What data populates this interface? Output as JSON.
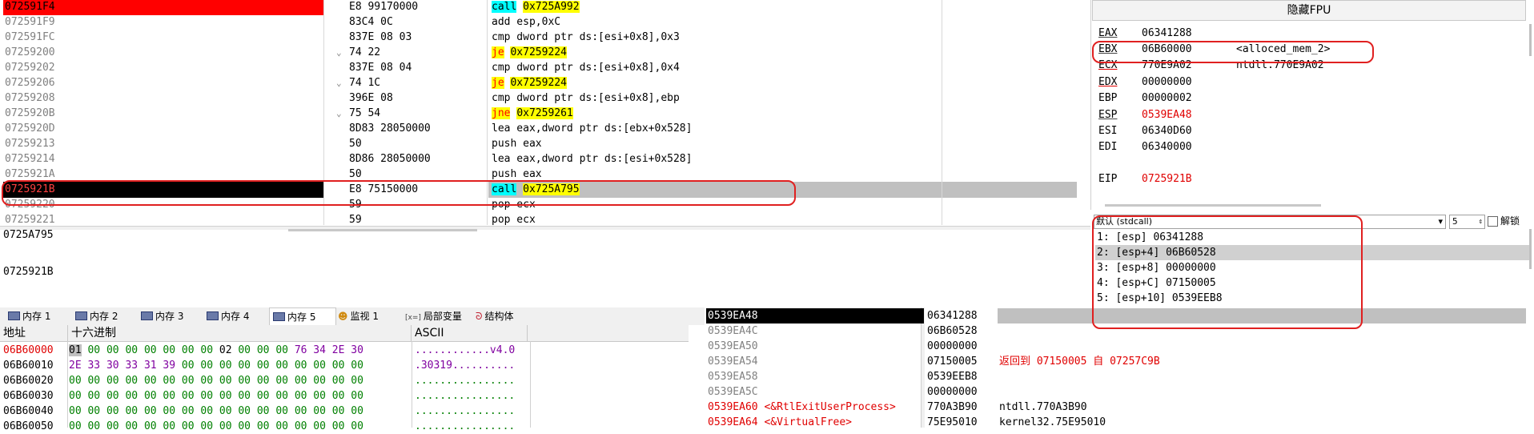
{
  "disasm": {
    "rows": [
      {
        "addr": "072591F4",
        "bytes": "E8 99170000",
        "jump": "",
        "mn": "call",
        "mnclass": "kw-call",
        "op": "",
        "tgt": "0x725A992"
      },
      {
        "addr": "072591F9",
        "bytes": "83C4 0C",
        "jump": "",
        "mn": "",
        "mnclass": "kw-plain",
        "op": "add esp,0xC",
        "tgt": ""
      },
      {
        "addr": "072591FC",
        "bytes": "837E 08 03",
        "jump": "",
        "mn": "",
        "mnclass": "kw-plain",
        "op": "cmp dword ptr ds:[esi+0x8],0x3",
        "tgt": ""
      },
      {
        "addr": "07259200",
        "bytes": "74 22",
        "jump": "⌄",
        "mn": "je",
        "mnclass": "kw-jmp",
        "op": "",
        "tgt": "0x7259224"
      },
      {
        "addr": "07259202",
        "bytes": "837E 08 04",
        "jump": "",
        "mn": "",
        "mnclass": "kw-plain",
        "op": "cmp dword ptr ds:[esi+0x8],0x4",
        "tgt": ""
      },
      {
        "addr": "07259206",
        "bytes": "74 1C",
        "jump": "⌄",
        "mn": "je",
        "mnclass": "kw-jmp",
        "op": "",
        "tgt": "0x7259224"
      },
      {
        "addr": "07259208",
        "bytes": "396E 08",
        "jump": "",
        "mn": "",
        "mnclass": "kw-plain",
        "op": "cmp dword ptr ds:[esi+0x8],ebp",
        "tgt": ""
      },
      {
        "addr": "0725920B",
        "bytes": "75 54",
        "jump": "⌄",
        "mn": "jne",
        "mnclass": "kw-jmp",
        "op": "",
        "tgt": "0x7259261"
      },
      {
        "addr": "0725920D",
        "bytes": "8D83 28050000",
        "jump": "",
        "mn": "",
        "mnclass": "kw-plain",
        "op": "lea eax,dword ptr ds:[ebx+0x528]",
        "tgt": ""
      },
      {
        "addr": "07259213",
        "bytes": "50",
        "jump": "",
        "mn": "",
        "mnclass": "kw-plain",
        "op": "push eax",
        "tgt": ""
      },
      {
        "addr": "07259214",
        "bytes": "8D86 28050000",
        "jump": "",
        "mn": "",
        "mnclass": "kw-plain",
        "op": "lea eax,dword ptr ds:[esi+0x528]",
        "tgt": ""
      },
      {
        "addr": "0725921A",
        "bytes": "50",
        "jump": "",
        "mn": "",
        "mnclass": "kw-plain",
        "op": "push eax",
        "tgt": ""
      },
      {
        "addr": "0725921B",
        "bytes": "E8 75150000",
        "jump": "",
        "mn": "call",
        "mnclass": "kw-call",
        "op": "",
        "tgt": "0x725A795"
      },
      {
        "addr": "07259220",
        "bytes": "59",
        "jump": "",
        "mn": "",
        "mnclass": "kw-plain",
        "op": "pop ecx",
        "tgt": ""
      },
      {
        "addr": "07259221",
        "bytes": "59",
        "jump": "",
        "mn": "",
        "mnclass": "kw-plain",
        "op": "pop ecx",
        "tgt": ""
      }
    ]
  },
  "info": {
    "line1": "0725A795",
    "line2": "0725921B"
  },
  "registers": {
    "fpu_label": "隐藏FPU",
    "items": [
      {
        "name": "EAX",
        "value": "06341288",
        "comment": "",
        "red": false,
        "line": "u"
      },
      {
        "name": "EBX",
        "value": "06B60000",
        "comment": "<alloced_mem_2>",
        "red": false,
        "line": "u"
      },
      {
        "name": "ECX",
        "value": "770E9A02",
        "comment": "ntdll.770E9A02",
        "red": false,
        "line": "redline"
      },
      {
        "name": "EDX",
        "value": "00000000",
        "comment": "",
        "red": false,
        "line": "redline"
      },
      {
        "name": "EBP",
        "value": "00000002",
        "comment": "",
        "red": false,
        "line": ""
      },
      {
        "name": "ESP",
        "value": "0539EA48",
        "comment": "",
        "red": true,
        "line": "u"
      },
      {
        "name": "ESI",
        "value": "06340D60",
        "comment": "",
        "red": false,
        "line": ""
      },
      {
        "name": "EDI",
        "value": "06340000",
        "comment": "",
        "red": false,
        "line": ""
      },
      {
        "name": "EIP",
        "value": "0725921B",
        "comment": "",
        "red": true,
        "line": ""
      }
    ]
  },
  "callargs": {
    "convention": "默认 (stdcall)",
    "count": "5",
    "unlock_label": "解锁",
    "items": [
      "1: [esp] 06341288",
      "2: [esp+4] 06B60528",
      "3: [esp+8] 00000000",
      "4: [esp+C] 07150005",
      "5: [esp+10] 0539EEB8"
    ]
  },
  "tabs": [
    "内存 1",
    "内存 2",
    "内存 3",
    "内存 4",
    "内存 5",
    "监视 1",
    "局部变量",
    "结构体"
  ],
  "tab_prefixes": {
    "locals": "[x=]"
  },
  "dump": {
    "headers": {
      "addr": "地址",
      "hex": "十六进制",
      "ascii": "ASCII"
    },
    "rows": [
      {
        "addr": "06B60000",
        "bytes": [
          "01",
          "00",
          "00",
          "00",
          "00",
          "00",
          "00",
          "00",
          "02",
          "00",
          "00",
          "00",
          "76",
          "34",
          "2E",
          "30"
        ],
        "ascii": "............v4.0"
      },
      {
        "addr": "06B60010",
        "bytes": [
          "2E",
          "33",
          "30",
          "33",
          "31",
          "39",
          "00",
          "00",
          "00",
          "00",
          "00",
          "00",
          "00",
          "00",
          "00",
          "00"
        ],
        "ascii": ".30319.........."
      },
      {
        "addr": "06B60020",
        "bytes": [
          "00",
          "00",
          "00",
          "00",
          "00",
          "00",
          "00",
          "00",
          "00",
          "00",
          "00",
          "00",
          "00",
          "00",
          "00",
          "00"
        ],
        "ascii": "................"
      },
      {
        "addr": "06B60030",
        "bytes": [
          "00",
          "00",
          "00",
          "00",
          "00",
          "00",
          "00",
          "00",
          "00",
          "00",
          "00",
          "00",
          "00",
          "00",
          "00",
          "00"
        ],
        "ascii": "................"
      },
      {
        "addr": "06B60040",
        "bytes": [
          "00",
          "00",
          "00",
          "00",
          "00",
          "00",
          "00",
          "00",
          "00",
          "00",
          "00",
          "00",
          "00",
          "00",
          "00",
          "00"
        ],
        "ascii": "................"
      },
      {
        "addr": "06B60050",
        "bytes": [
          "00",
          "00",
          "00",
          "00",
          "00",
          "00",
          "00",
          "00",
          "00",
          "00",
          "00",
          "00",
          "00",
          "00",
          "00",
          "00"
        ],
        "ascii": "................"
      }
    ]
  },
  "stack": {
    "rows": [
      {
        "addr": "0539EA48",
        "value": "06341288",
        "comment": "",
        "addrRed": false,
        "commentRed": false
      },
      {
        "addr": "0539EA4C",
        "value": "06B60528",
        "comment": "",
        "addrRed": false,
        "commentRed": false
      },
      {
        "addr": "0539EA50",
        "value": "00000000",
        "comment": "",
        "addrRed": false,
        "commentRed": false
      },
      {
        "addr": "0539EA54",
        "value": "07150005",
        "comment": "返回到 07150005 自 07257C9B",
        "addrRed": false,
        "commentRed": true
      },
      {
        "addr": "0539EA58",
        "value": "0539EEB8",
        "comment": "",
        "addrRed": false,
        "commentRed": false
      },
      {
        "addr": "0539EA5C",
        "value": "00000000",
        "comment": "",
        "addrRed": false,
        "commentRed": false
      },
      {
        "addr": "0539EA60 <&RtlExitUserProcess>",
        "value": "770A3B90",
        "comment": "ntdll.770A3B90",
        "addrRed": true,
        "commentRed": false
      },
      {
        "addr": "0539EA64 <&VirtualFree>",
        "value": "75E95010",
        "comment": "kernel32.75E95010",
        "addrRed": true,
        "commentRed": false
      }
    ]
  },
  "colors": {
    "accent_red": "#e00000",
    "call_bg": "#00ffff",
    "jump_bg": "#ffff00",
    "annotation": "#e02020"
  }
}
